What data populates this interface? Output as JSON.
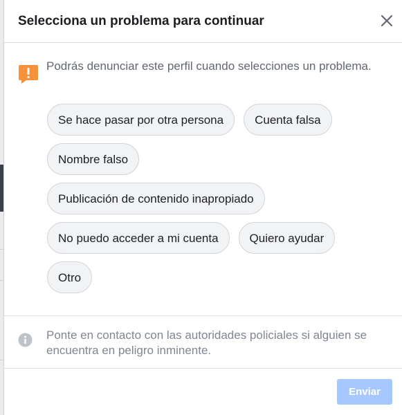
{
  "dialog": {
    "title": "Selecciona un problema para continuar",
    "close_icon": "close-icon"
  },
  "notice": {
    "icon": "warning-icon",
    "icon_color": "#f7923b",
    "text": "Podrás denunciar este perfil cuando selecciones un problema."
  },
  "options": [
    [
      "Se hace pasar por otra persona",
      "Cuenta falsa"
    ],
    [
      "Nombre falso"
    ],
    [
      "Publicación de contenido inapropiado"
    ],
    [
      "No puedo acceder a mi cuenta",
      "Quiero ayudar"
    ],
    [
      "Otro"
    ]
  ],
  "info": {
    "icon": "info-icon",
    "text": "Ponte en contacto con las autoridades policiales si alguien se encuentra en peligro inminente."
  },
  "footer": {
    "send_label": "Enviar",
    "send_color": "#a6c7ff"
  }
}
